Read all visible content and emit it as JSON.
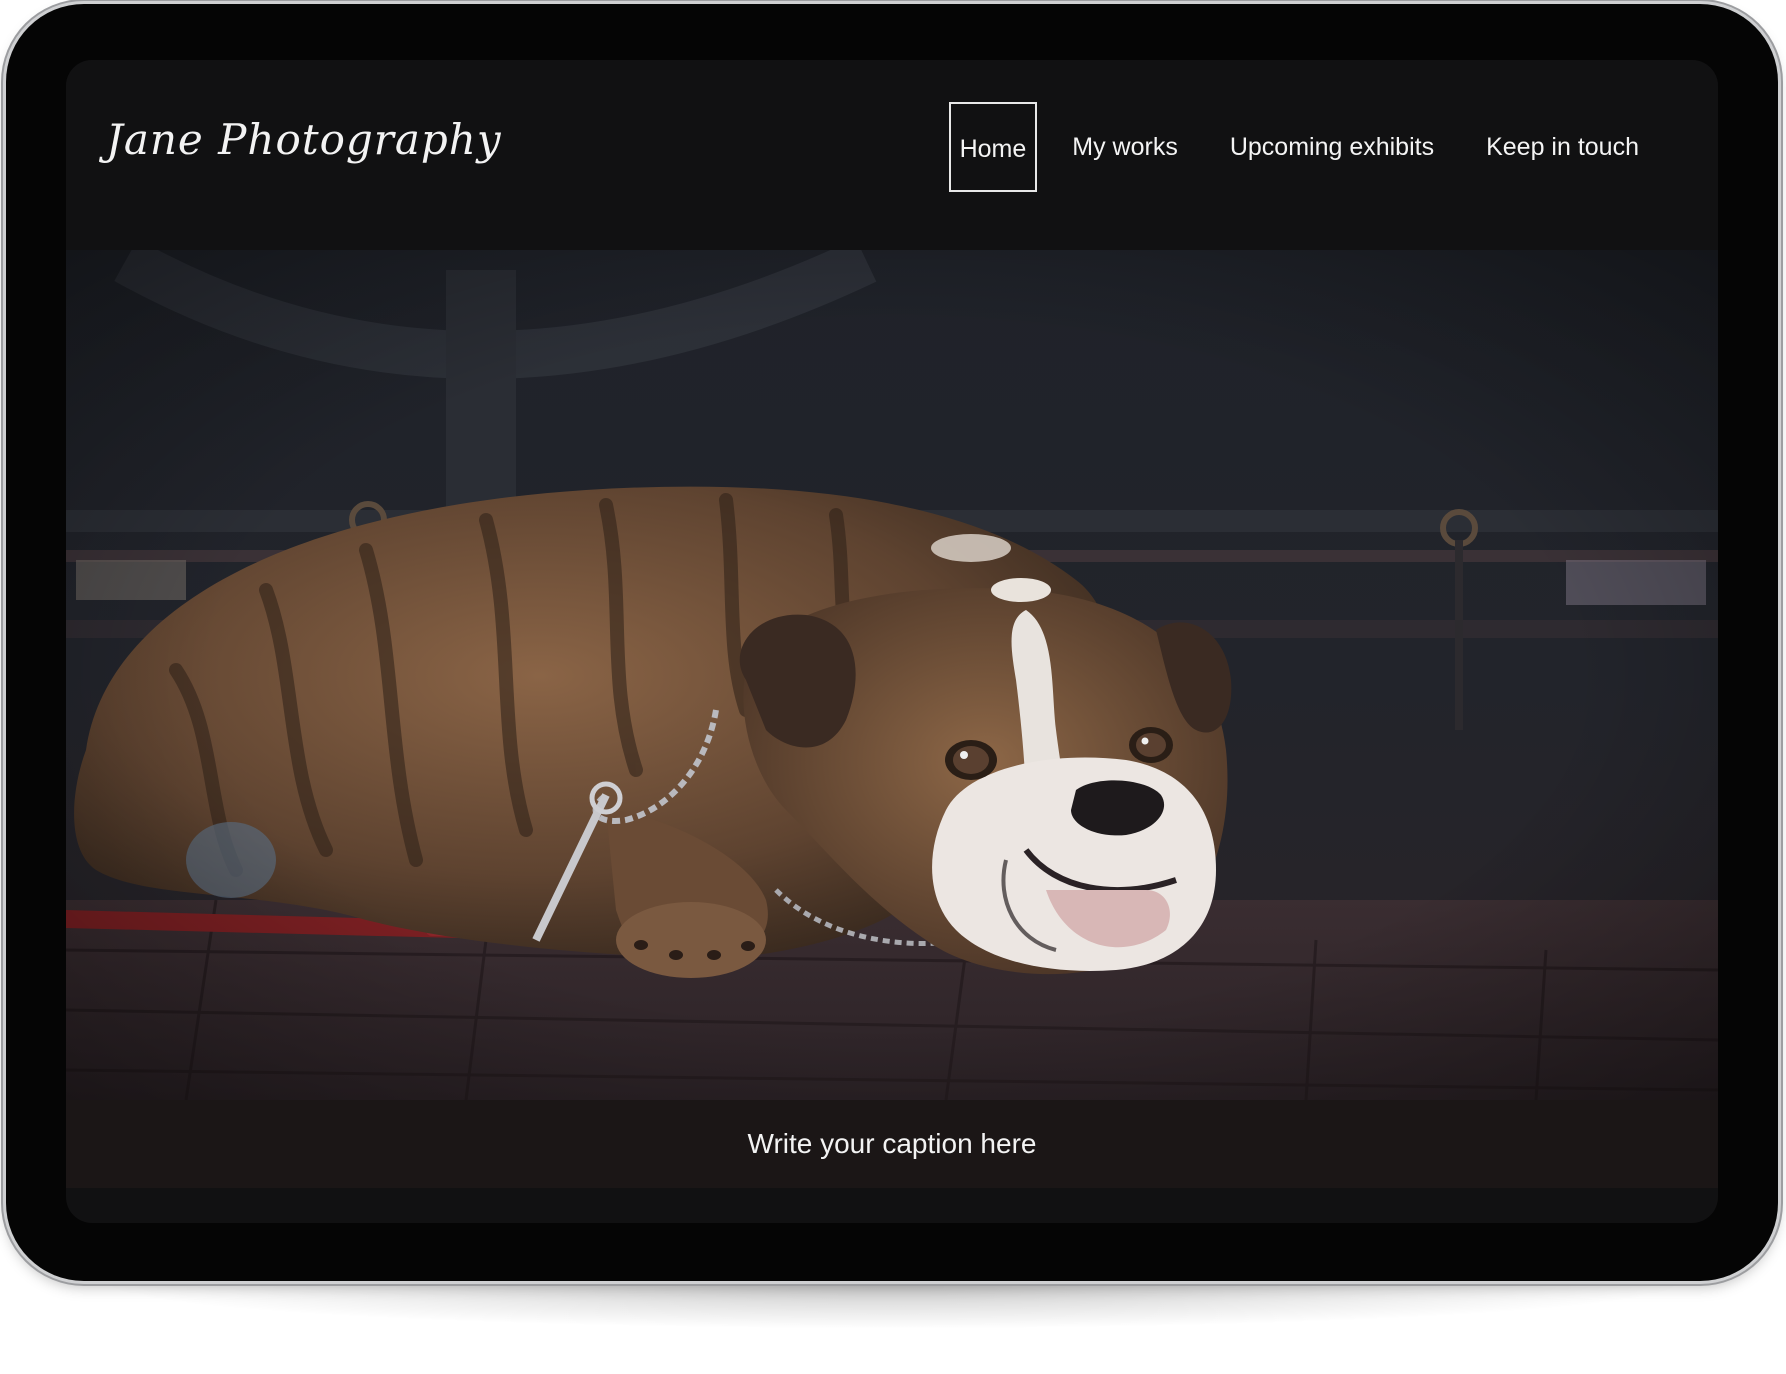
{
  "site": {
    "logo": "Jane Photography"
  },
  "nav": {
    "items": [
      {
        "label": "Home",
        "active": true
      },
      {
        "label": "My works",
        "active": false
      },
      {
        "label": "Upcoming exhibits",
        "active": false
      },
      {
        "label": "Keep in touch",
        "active": false
      }
    ]
  },
  "hero": {
    "caption": "Write your caption here"
  },
  "colors": {
    "page_bg": "#111112",
    "text": "#f4f4f4",
    "caption_bg": "#1b1616"
  }
}
